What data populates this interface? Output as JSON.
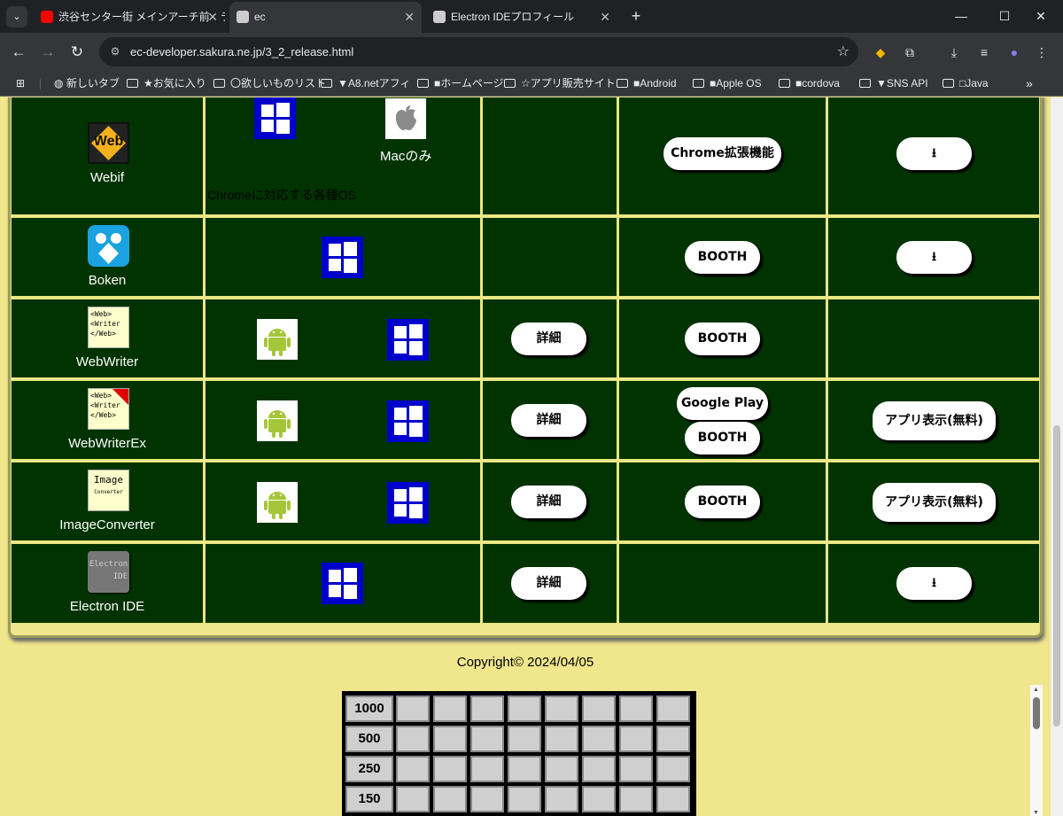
{
  "browser": {
    "tabs": [
      {
        "title": "渋谷センター街 メインアーチ前　ライ",
        "favicon": "youtube-icon"
      },
      {
        "title": "ec",
        "favicon": "page-icon"
      },
      {
        "title": "Electron IDEプロフィール",
        "favicon": "page-icon"
      }
    ],
    "url": "ec-developer.sakura.ne.jp/3_2_release.html",
    "bookmarks": [
      "新しいタブ",
      "★お気に入り",
      "〇欲しいものリスト",
      "▼A8.netアフィ",
      "■ホームページ",
      "☆アプリ販売サイト",
      "■Android",
      "■Apple OS",
      "■cordova",
      "▼SNS API",
      "□Java"
    ]
  },
  "apps": [
    {
      "name": "Webif",
      "mac_note": "Macのみ",
      "os_note": "Chromeに対応する各種OS",
      "store": [
        "Chrome拡張機能"
      ],
      "download": "⭳"
    },
    {
      "name": "Boken",
      "store": [
        "BOOTH"
      ],
      "download": "⭳"
    },
    {
      "name": "WebWriter",
      "detail": "詳細",
      "store": [
        "BOOTH"
      ]
    },
    {
      "name": "WebWriterEx",
      "detail": "詳細",
      "store": [
        "Google Play",
        "BOOTH"
      ],
      "download": "アプリ表示(無料)"
    },
    {
      "name": "ImageConverter",
      "detail": "詳細",
      "store": [
        "BOOTH"
      ],
      "download": "アプリ表示(無料)"
    },
    {
      "name": "Electron IDE",
      "detail": "詳細",
      "download": "⭳"
    }
  ],
  "icon_text": {
    "webif": "Web",
    "webwriter": "<Web> <Writer </Web>",
    "imageconverter": [
      "Image",
      "Converter"
    ],
    "electron": [
      "Electron",
      "IDE"
    ]
  },
  "copyright": "Copyright© 2024/04/05",
  "score_labels": [
    "1000",
    "500",
    "250",
    "150"
  ],
  "colors": {
    "page_bg": "#f0e68c",
    "cell_bg": "#003300",
    "cell_border": "#e6e67a",
    "windows_blue": "#0000cc",
    "android_green": "#a4c639"
  }
}
